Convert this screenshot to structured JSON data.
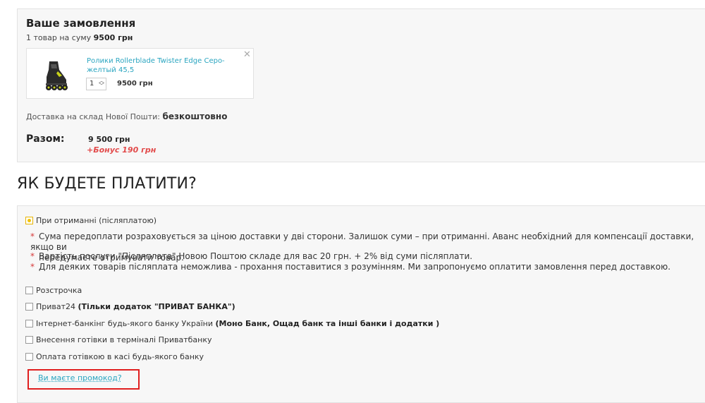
{
  "order": {
    "title": "Ваше замовлення",
    "summary_prefix": "1 товар на суму",
    "summary_amount": "9500 грн",
    "product": {
      "name": "Ролики Rollerblade Twister Edge Серо-желтый 45,5",
      "quantity": "1",
      "price": "9500 грн",
      "image_icon": "inline-skate-icon"
    },
    "delivery_label": "Доставка на склад Нової Пошти:",
    "delivery_value": "безкоштовно",
    "total_label": "Разом:",
    "total_value": "9 500 грн",
    "bonus": "+Бонус 190 грн"
  },
  "payment": {
    "heading": "ЯК БУДЕТЕ ПЛАТИТИ?",
    "options": [
      {
        "label": "При отриманні (післяплатою)",
        "bold": "",
        "selected": true
      },
      {
        "label": "Розстрочка",
        "bold": "",
        "selected": false
      },
      {
        "label": "Приват24",
        "bold": "(Тільки додаток \"ПРИВАТ БАНКА\")",
        "selected": false
      },
      {
        "label": "Інтернет-банкінг будь-якого банку України",
        "bold": "(Моно Банк, Ощад банк та інші банки і додатки )",
        "selected": false
      },
      {
        "label": "Внесення готівки в терміналі Приватбанку",
        "bold": "",
        "selected": false
      },
      {
        "label": "Оплата готівкою в касі будь-якого банку",
        "bold": "",
        "selected": false
      }
    ],
    "notes": [
      {
        "line1": "Сума передоплати розраховується за ціною доставки у дві сторони. Залишок суми – при отриманні. Аванс необхідний для компенсації доставки, якщо ви",
        "line2": "передумаєте отримувати товар."
      },
      {
        "line1": "Вартість послуги \"Післяплата\" Новою Поштою складе для вас 20 грн. + 2% від суми післяплати.",
        "line2": ""
      },
      {
        "line1": "Для деяких товарів післяплата неможлива - прохання поставитися з розумінням. Ми запропонуємо оплатити замовлення перед доставкою.",
        "line2": ""
      }
    ],
    "promo_link": "Ви маєте промокод?"
  },
  "colors": {
    "accent_link": "#2aa5c0",
    "bonus_red": "#e24b4b",
    "highlight_red": "#e01e1e",
    "radio_yellow": "#f2c200"
  }
}
